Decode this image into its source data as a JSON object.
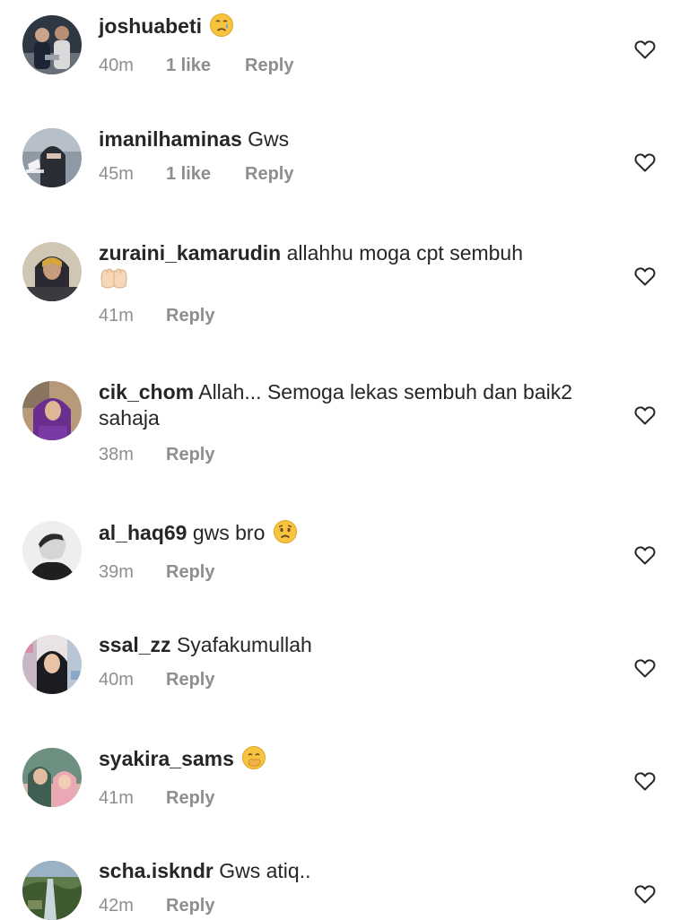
{
  "colors": {
    "text": "#262626",
    "meta": "#8e8e8e",
    "heart_outline": "#262626"
  },
  "comments": [
    {
      "username": "joshuabeti",
      "text": "",
      "emoji": "crying-face",
      "time": "40m",
      "likes": "1 like",
      "reply": "Reply",
      "avatar": "avatar-two-people"
    },
    {
      "username": "imanilhaminas",
      "text": "Gws",
      "emoji": "",
      "time": "45m",
      "likes": "1 like",
      "reply": "Reply",
      "avatar": "avatar-veiled-woman"
    },
    {
      "username": "zuraini_kamarudin",
      "text": "allahhu moga cpt sembuh",
      "emoji": "palms-up-together",
      "time": "41m",
      "likes": "",
      "reply": "Reply",
      "avatar": "avatar-hijab-woman"
    },
    {
      "username": "cik_chom",
      "text": "Allah... Semoga lekas sembuh dan baik2 sahaja",
      "emoji": "",
      "time": "38m",
      "likes": "",
      "reply": "Reply",
      "avatar": "avatar-purple-hijab"
    },
    {
      "username": "al_haq69",
      "text": "gws bro",
      "emoji": "worried-face",
      "time": "39m",
      "likes": "",
      "reply": "Reply",
      "avatar": "avatar-man-bw"
    },
    {
      "username": "ssal_zz",
      "text": "Syafakumullah",
      "emoji": "",
      "time": "40m",
      "likes": "",
      "reply": "Reply",
      "avatar": "avatar-collage"
    },
    {
      "username": "syakira_sams",
      "text": "",
      "emoji": "face-with-hand-over-mouth",
      "time": "41m",
      "likes": "",
      "reply": "Reply",
      "avatar": "avatar-two-women"
    },
    {
      "username": "scha.iskndr",
      "text": "Gws atiq..",
      "emoji": "",
      "time": "42m",
      "likes": "",
      "reply": "Reply",
      "avatar": "avatar-landscape"
    }
  ]
}
